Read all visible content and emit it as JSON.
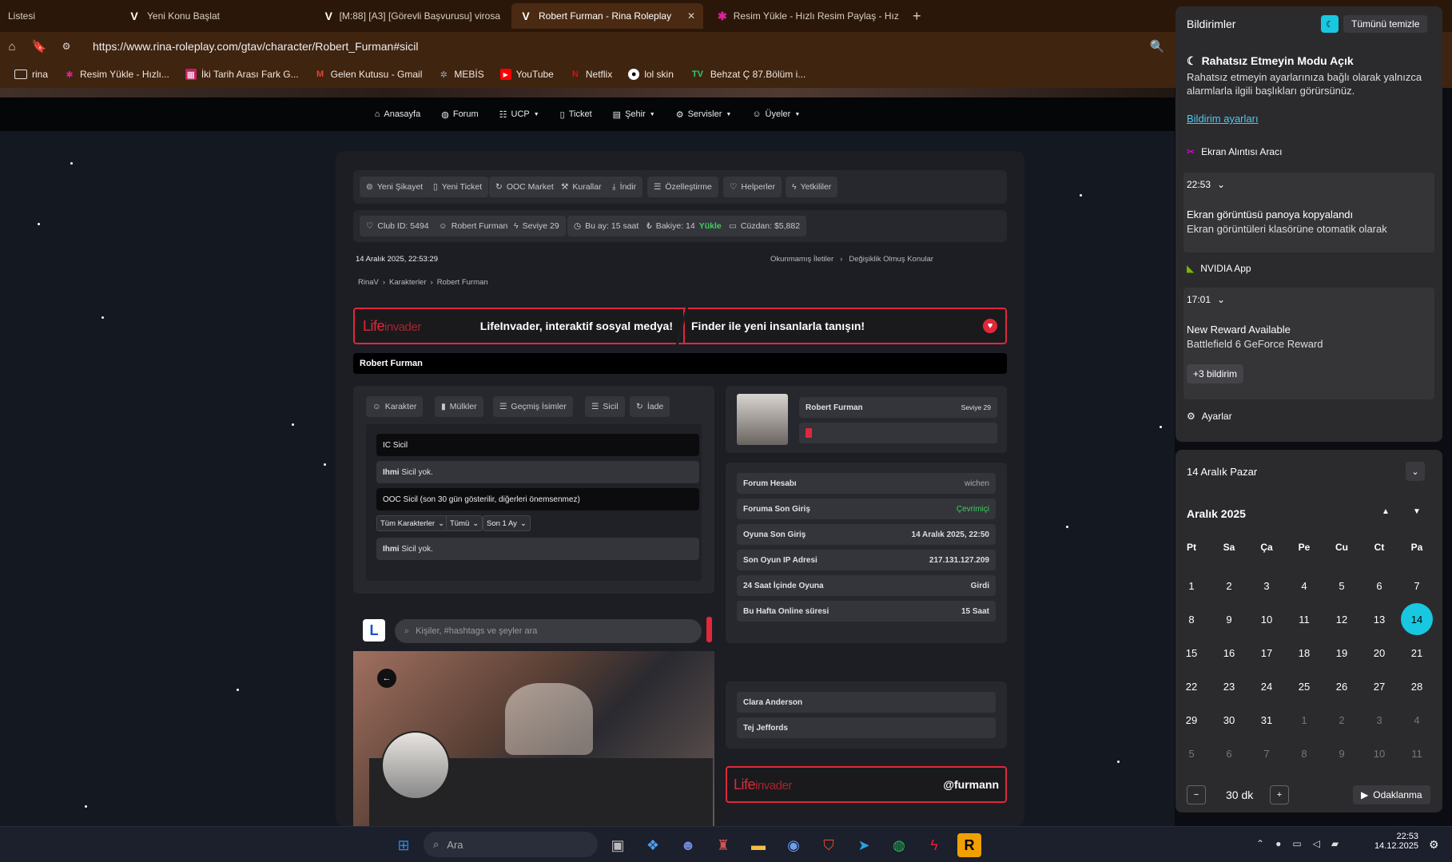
{
  "browser": {
    "tabs": [
      {
        "title": "Listesi",
        "icon": ""
      },
      {
        "title": "Yeni Konu Başlat",
        "icon": "V"
      },
      {
        "title": "[M:88] [A3] [Görevli Başvurusu] virosa",
        "icon": "V"
      },
      {
        "title": "Robert Furman - Rina Roleplay G",
        "icon": "V",
        "active": true
      },
      {
        "title": "Resim Yükle - Hızlı Resim Paylaş - Hız",
        "icon": "✱"
      }
    ],
    "url": "https://www.rina-roleplay.com/gtav/character/Robert_Furman#sicil",
    "bookmarks": [
      "rina",
      "Resim Yükle - Hızlı...",
      "İki Tarih Arası Fark G...",
      "Gelen Kutusu - Gmail",
      "MEBİS",
      "YouTube",
      "Netflix",
      "lol skin",
      "Behzat Ç 87.Bölüm i..."
    ]
  },
  "site": {
    "nav": [
      "Anasayfa",
      "Forum",
      "UCP",
      "Ticket",
      "Şehir",
      "Servisler",
      "Üyeler"
    ],
    "quick_links": [
      "Yeni Şikayet",
      "Yeni Ticket",
      "OOC Market",
      "Kurallar",
      "İndir",
      "Özelleştirme",
      "Helperler",
      "Yetkililer"
    ],
    "stats": {
      "club_id": "Club ID: 5494",
      "user": "Robert Furman",
      "level": "Seviye 29",
      "month": "Bu ay: 15 saat",
      "balance": "Bakiye: 14",
      "balance_action": "Yükle",
      "wallet": "Cüzdan: $5,882"
    },
    "date": "14 Aralık 2025, 22:53:29",
    "unread": "Okunmamış İletiler",
    "changed": "Değişiklik Olmuş Konular",
    "breadcrumb": [
      "RinaV",
      "Karakterler",
      "Robert Furman"
    ],
    "lifeinvader_banner": {
      "logo_a": "Life",
      "logo_b": "invader",
      "left": "LifeInvader, interaktif sosyal medya!",
      "right": "Finder ile yeni insanlarla tanışın!"
    },
    "character_title": "Robert Furman",
    "char_tabs": [
      "Karakter",
      "Mülkler",
      "Geçmiş İsimler",
      "Sicil",
      "İade"
    ],
    "ic_title": "IC Sicil",
    "ic_empty_name": "Ihmi",
    "ic_empty_text": " Sicil yok.",
    "ooc_title": "OOC Sicil (son 30 gün gösterilir, diğerleri önemsenmez)",
    "filters": [
      "Tüm Karakterler",
      "Tümü",
      "Son 1 Ay"
    ],
    "ooc_empty_name": "Ihmi",
    "ooc_empty_text": " Sicil yok.",
    "profile": {
      "name": "Robert Furman",
      "level": "Seviye 29"
    },
    "info_rows": [
      {
        "label": "Forum Hesabı",
        "value": "wichen",
        "green": false
      },
      {
        "label": "Foruma Son Giriş",
        "value": "Çevrimiçi",
        "green": true
      },
      {
        "label": "Oyuna Son Giriş",
        "value": "14 Aralık 2025, 22:50",
        "green": false
      },
      {
        "label": "Son Oyun IP Adresi",
        "value": "217.131.127.209",
        "green": false
      },
      {
        "label": "24 Saat İçinde Oyuna",
        "value": "Girdi",
        "green": false
      },
      {
        "label": "Bu Hafta Online süresi",
        "value": "15 Saat",
        "green": false
      }
    ],
    "other_chars": [
      "Clara Anderson",
      "Tej Jeffords"
    ],
    "li_handle": "@furmann",
    "search_placeholder": "Kişiler, #hashtags ve şeyler ara"
  },
  "notifications": {
    "title": "Bildirimler",
    "clear_all": "Tümünü temizle",
    "dnd_title": "Rahatsız Etmeyin Modu Açık",
    "dnd_text": "Rahatsız etmeyin ayarlarınıza bağlı olarak yalnızca alarmlarla ilgili başlıkları görürsünüz.",
    "settings_link": "Bildirim ayarları",
    "app1": "Ekran Alıntısı Aracı",
    "time1": "22:53",
    "n1_title": "Ekran görüntüsü panoya kopyalandı",
    "n1_text": "Ekran görüntüleri klasörüne otomatik olarak",
    "app2": "NVIDIA App",
    "time2": "17:01",
    "n2_title": "New Reward Available",
    "n2_text": "Battlefield 6 GeForce Reward",
    "more": "+3 bildirim",
    "settings": "Ayarlar"
  },
  "calendar": {
    "date_header": "14 Aralık Pazar",
    "month": "Aralık 2025",
    "weekdays": [
      "Pt",
      "Sa",
      "Ça",
      "Pe",
      "Cu",
      "Ct",
      "Pa"
    ],
    "days": [
      [
        "1",
        "2",
        "3",
        "4",
        "5",
        "6",
        "7"
      ],
      [
        "8",
        "9",
        "10",
        "11",
        "12",
        "13",
        "14"
      ],
      [
        "15",
        "16",
        "17",
        "18",
        "19",
        "20",
        "21"
      ],
      [
        "22",
        "23",
        "24",
        "25",
        "26",
        "27",
        "28"
      ],
      [
        "29",
        "30",
        "31",
        "1",
        "2",
        "3",
        "4"
      ],
      [
        "5",
        "6",
        "7",
        "8",
        "9",
        "10",
        "11"
      ]
    ],
    "today": "14",
    "focus_minutes": "30 dk",
    "focus_button": "Odaklanma"
  },
  "taskbar": {
    "search": "Ara",
    "time": "22:53",
    "date": "14.12.2025"
  }
}
